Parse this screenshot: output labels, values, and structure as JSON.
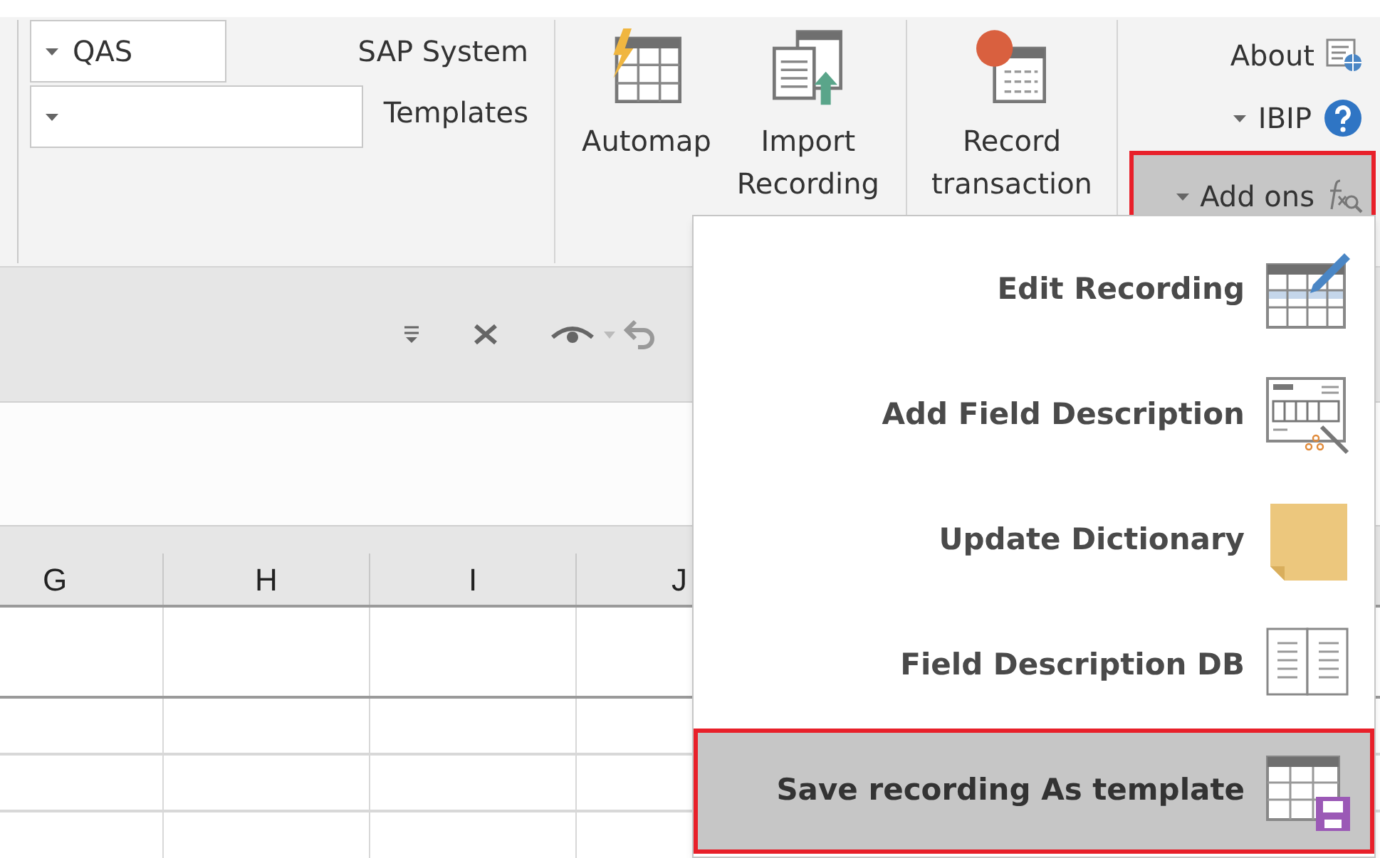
{
  "ribbon": {
    "system_combo": {
      "value": "QAS"
    },
    "system_label": "SAP System",
    "templates_label": "Templates",
    "large_buttons": [
      {
        "kind": "automap",
        "label": "Automap"
      },
      {
        "kind": "import",
        "label": "Import\nRecording"
      },
      {
        "kind": "record",
        "label": "Record\ntransaction"
      }
    ],
    "small_buttons": [
      {
        "kind": "about",
        "label": "About",
        "dropdown": false,
        "selected": false,
        "annotated": false
      },
      {
        "kind": "help",
        "label": "IBIP",
        "dropdown": true,
        "selected": false,
        "annotated": false
      },
      {
        "kind": "addons",
        "label": "Add ons",
        "dropdown": true,
        "selected": true,
        "annotated": true
      }
    ]
  },
  "sheet": {
    "columns": [
      "G",
      "H",
      "I",
      "J"
    ]
  },
  "menu": {
    "items": [
      {
        "kind": "edit",
        "label": "Edit Recording",
        "selected": false,
        "annotated": false
      },
      {
        "kind": "field",
        "label": "Add Field Description",
        "selected": false,
        "annotated": false
      },
      {
        "kind": "note",
        "label": "Update Dictionary",
        "selected": false,
        "annotated": false
      },
      {
        "kind": "db",
        "label": "Field Description DB",
        "selected": false,
        "annotated": false
      },
      {
        "kind": "save",
        "label": "Save recording As template",
        "selected": true,
        "annotated": true
      }
    ]
  }
}
